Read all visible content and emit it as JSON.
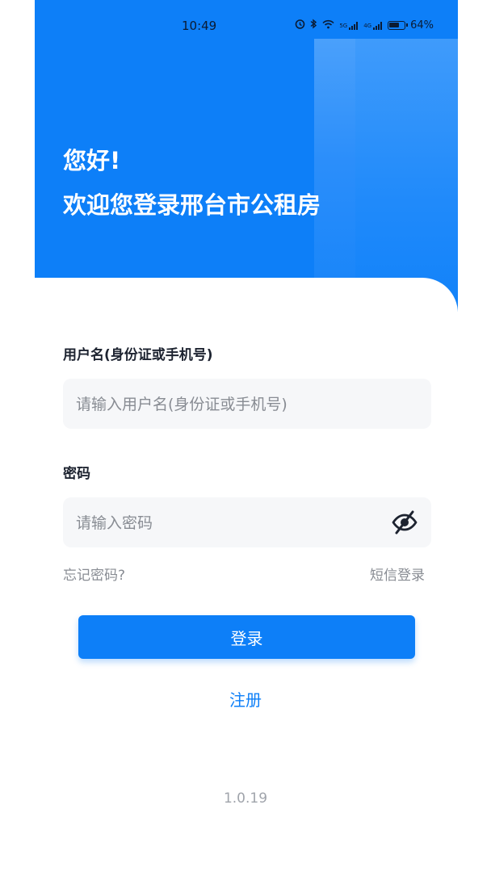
{
  "status_bar": {
    "time": "10:49",
    "network_1": "5G",
    "network_2": "4G",
    "battery": "64%"
  },
  "header": {
    "greeting": "您好!",
    "welcome": "欢迎您登录邢台市公租房"
  },
  "form": {
    "username": {
      "label": "用户名(身份证或手机号)",
      "value": "",
      "placeholder": "请输入用户名(身份证或手机号)"
    },
    "password": {
      "label": "密码",
      "value": "",
      "placeholder": "请输入密码",
      "visibility_icon": "eye-off-icon"
    },
    "forgot_password": "忘记密码?",
    "sms_login": "短信登录",
    "login_button": "登录",
    "register_link": "注册"
  },
  "footer": {
    "version": "1.0.19"
  },
  "colors": {
    "primary": "#0d7ff8",
    "field_bg": "#f6f7f9",
    "muted_text": "#888c93"
  }
}
